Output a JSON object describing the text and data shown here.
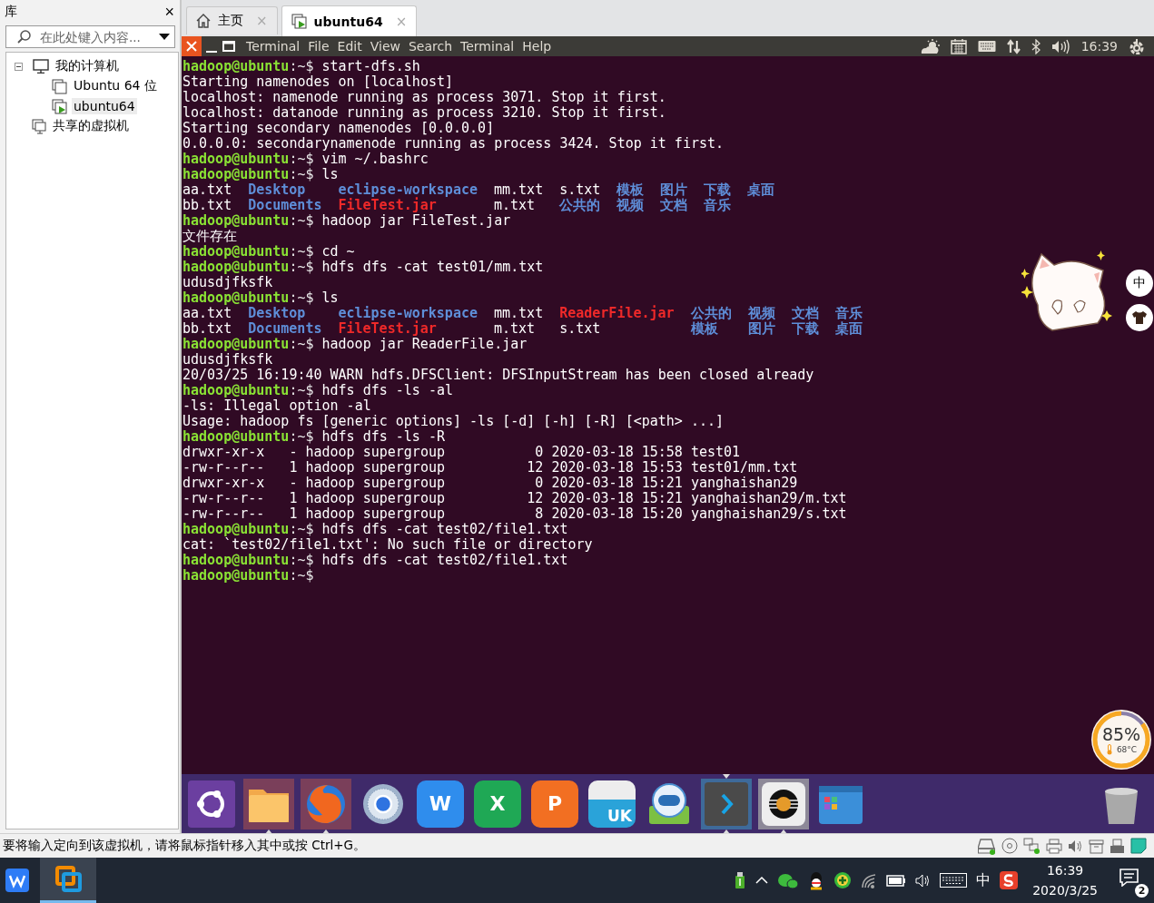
{
  "library": {
    "title": "库",
    "close": "×",
    "search": {
      "placeholder": "在此处键入内容..."
    },
    "tree": [
      {
        "label": "我的计算机",
        "kind": "computer",
        "expanded": true,
        "selected": false,
        "children": [
          {
            "label": "Ubuntu 64 位",
            "kind": "vm",
            "running": false,
            "selected": false
          },
          {
            "label": "ubuntu64",
            "kind": "vm",
            "running": true,
            "selected": true
          }
        ]
      },
      {
        "label": "共享的虚拟机",
        "kind": "shared",
        "selected": false
      }
    ]
  },
  "tabs": [
    {
      "label": "主页",
      "kind": "home",
      "selected": false,
      "close": "×"
    },
    {
      "label": "ubuntu64",
      "kind": "vm",
      "selected": true,
      "close": "×"
    }
  ],
  "top_panel": {
    "menu": [
      "Terminal",
      "File",
      "Edit",
      "View",
      "Search",
      "Terminal",
      "Help"
    ],
    "clock": "16:39"
  },
  "terminal": {
    "lines": [
      {
        "kind": "prompt",
        "user": "hadoop@ubuntu",
        "prompt": ":~$",
        "command": "start-dfs.sh"
      },
      {
        "kind": "output",
        "text": "Starting namenodes on [localhost]"
      },
      {
        "kind": "output",
        "text": "localhost: namenode running as process 3071. Stop it first."
      },
      {
        "kind": "output",
        "text": "localhost: datanode running as process 3210. Stop it first."
      },
      {
        "kind": "output",
        "text": "Starting secondary namenodes [0.0.0.0]"
      },
      {
        "kind": "output",
        "text": "0.0.0.0: secondarynamenode running as process 3424. Stop it first."
      },
      {
        "kind": "prompt",
        "user": "hadoop@ubuntu",
        "prompt": ":~$",
        "command": "vim ~/.bashrc"
      },
      {
        "kind": "prompt",
        "user": "hadoop@ubuntu",
        "prompt": ":~$",
        "command": "ls"
      },
      {
        "kind": "ls",
        "columns": [
          [
            {
              "name": "aa.txt",
              "kind": "file"
            },
            {
              "name": "bb.txt",
              "kind": "file"
            }
          ],
          [
            {
              "name": "Desktop",
              "kind": "dir"
            },
            {
              "name": "Documents",
              "kind": "dir"
            }
          ],
          [
            {
              "name": "eclipse-workspace",
              "kind": "dir"
            },
            {
              "name": "FileTest.jar",
              "kind": "jar"
            }
          ],
          [
            {
              "name": "mm.txt",
              "kind": "file"
            },
            {
              "name": "m.txt",
              "kind": "file"
            }
          ],
          [
            {
              "name": "s.txt",
              "kind": "file"
            },
            {
              "name": "公共的",
              "kind": "dir"
            }
          ],
          [
            {
              "name": "模板",
              "kind": "dir"
            },
            {
              "name": "视频",
              "kind": "dir"
            }
          ],
          [
            {
              "name": "图片",
              "kind": "dir"
            },
            {
              "name": "文档",
              "kind": "dir"
            }
          ],
          [
            {
              "name": "下载",
              "kind": "dir"
            },
            {
              "name": "音乐",
              "kind": "dir"
            }
          ],
          [
            {
              "name": "桌面",
              "kind": "dir"
            }
          ]
        ]
      },
      {
        "kind": "prompt",
        "user": "hadoop@ubuntu",
        "prompt": ":~$",
        "command": "hadoop jar FileTest.jar"
      },
      {
        "kind": "output",
        "text": "文件存在"
      },
      {
        "kind": "prompt",
        "user": "hadoop@ubuntu",
        "prompt": ":~$",
        "command": "cd ~"
      },
      {
        "kind": "prompt",
        "user": "hadoop@ubuntu",
        "prompt": ":~$",
        "command": "hdfs dfs -cat test01/mm.txt"
      },
      {
        "kind": "output",
        "text": "udusdjfksfk"
      },
      {
        "kind": "prompt",
        "user": "hadoop@ubuntu",
        "prompt": ":~$",
        "command": "ls"
      },
      {
        "kind": "ls",
        "columns": [
          [
            {
              "name": "aa.txt",
              "kind": "file"
            },
            {
              "name": "bb.txt",
              "kind": "file"
            }
          ],
          [
            {
              "name": "Desktop",
              "kind": "dir"
            },
            {
              "name": "Documents",
              "kind": "dir"
            }
          ],
          [
            {
              "name": "eclipse-workspace",
              "kind": "dir"
            },
            {
              "name": "FileTest.jar",
              "kind": "jar"
            }
          ],
          [
            {
              "name": "mm.txt",
              "kind": "file"
            },
            {
              "name": "m.txt",
              "kind": "file"
            }
          ],
          [
            {
              "name": "ReaderFile.jar",
              "kind": "jar"
            },
            {
              "name": "s.txt",
              "kind": "file"
            }
          ],
          [
            {
              "name": "公共的",
              "kind": "dir"
            },
            {
              "name": "模板",
              "kind": "dir"
            }
          ],
          [
            {
              "name": "视频",
              "kind": "dir"
            },
            {
              "name": "图片",
              "kind": "dir"
            }
          ],
          [
            {
              "name": "文档",
              "kind": "dir"
            },
            {
              "name": "下载",
              "kind": "dir"
            }
          ],
          [
            {
              "name": "音乐",
              "kind": "dir"
            },
            {
              "name": "桌面",
              "kind": "dir"
            }
          ]
        ]
      },
      {
        "kind": "prompt",
        "user": "hadoop@ubuntu",
        "prompt": ":~$",
        "command": "hadoop jar ReaderFile.jar"
      },
      {
        "kind": "output",
        "text": "udusdjfksfk"
      },
      {
        "kind": "output",
        "text": "20/03/25 16:19:40 WARN hdfs.DFSClient: DFSInputStream has been closed already"
      },
      {
        "kind": "prompt",
        "user": "hadoop@ubuntu",
        "prompt": ":~$",
        "command": "hdfs dfs -ls -al"
      },
      {
        "kind": "output",
        "text": "-ls: Illegal option -al"
      },
      {
        "kind": "output",
        "text": "Usage: hadoop fs [generic options] -ls [-d] [-h] [-R] [<path> ...]"
      },
      {
        "kind": "prompt",
        "user": "hadoop@ubuntu",
        "prompt": ":~$",
        "command": "hdfs dfs -ls -R"
      },
      {
        "kind": "output",
        "text": "drwxr-xr-x   - hadoop supergroup           0 2020-03-18 15:58 test01"
      },
      {
        "kind": "output",
        "text": "-rw-r--r--   1 hadoop supergroup          12 2020-03-18 15:53 test01/mm.txt"
      },
      {
        "kind": "output",
        "text": "drwxr-xr-x   - hadoop supergroup           0 2020-03-18 15:21 yanghaishan29"
      },
      {
        "kind": "output",
        "text": "-rw-r--r--   1 hadoop supergroup          12 2020-03-18 15:21 yanghaishan29/m.txt"
      },
      {
        "kind": "output",
        "text": "-rw-r--r--   1 hadoop supergroup           8 2020-03-18 15:20 yanghaishan29/s.txt"
      },
      {
        "kind": "prompt",
        "user": "hadoop@ubuntu",
        "prompt": ":~$",
        "command": "hdfs dfs -cat test02/file1.txt"
      },
      {
        "kind": "output",
        "text": "cat: `test02/file1.txt': No such file or directory"
      },
      {
        "kind": "prompt",
        "user": "hadoop@ubuntu",
        "prompt": ":~$",
        "command": "hdfs dfs -cat test02/file1.txt"
      },
      {
        "kind": "prompt",
        "user": "hadoop@ubuntu",
        "prompt": ":~$"
      }
    ]
  },
  "ime_buttons": [
    {
      "kind": "text",
      "label": "中"
    },
    {
      "kind": "skin"
    }
  ],
  "cpu_meter": {
    "reading": "85%",
    "temperature": "68°C",
    "level": 0.85
  },
  "dock": {
    "items": [
      {
        "kind": "ubuntu",
        "running": false,
        "focused": false
      },
      {
        "kind": "files",
        "running": true,
        "focused": false
      },
      {
        "kind": "firefox",
        "running": true,
        "focused": false
      },
      {
        "kind": "browser",
        "running": false,
        "focused": false
      },
      {
        "kind": "word",
        "label": "W",
        "running": false,
        "focused": false
      },
      {
        "kind": "excel",
        "label": "X",
        "running": false,
        "focused": false
      },
      {
        "kind": "powerpoint",
        "label": "P",
        "running": false,
        "focused": false
      },
      {
        "kind": "store",
        "label": "UK",
        "running": false,
        "focused": false
      },
      {
        "kind": "robot",
        "running": false,
        "focused": false
      },
      {
        "kind": "terminal",
        "running": true,
        "focused": true
      },
      {
        "kind": "disc",
        "running": true,
        "focused": false
      },
      {
        "kind": "window",
        "running": false,
        "focused": false
      },
      {
        "kind": "trash",
        "running": false,
        "focused": false
      }
    ]
  },
  "status_bar": {
    "message": "要将输入定向到该虚拟机，请将鼠标指针移入其中或按 Ctrl+G。"
  },
  "taskbar": {
    "apps": [
      {
        "kind": "wps",
        "selected": false
      },
      {
        "kind": "vmware",
        "selected": true
      }
    ],
    "ime": "中",
    "time": "16:39",
    "date": "2020/3/25",
    "notifications": "2"
  }
}
